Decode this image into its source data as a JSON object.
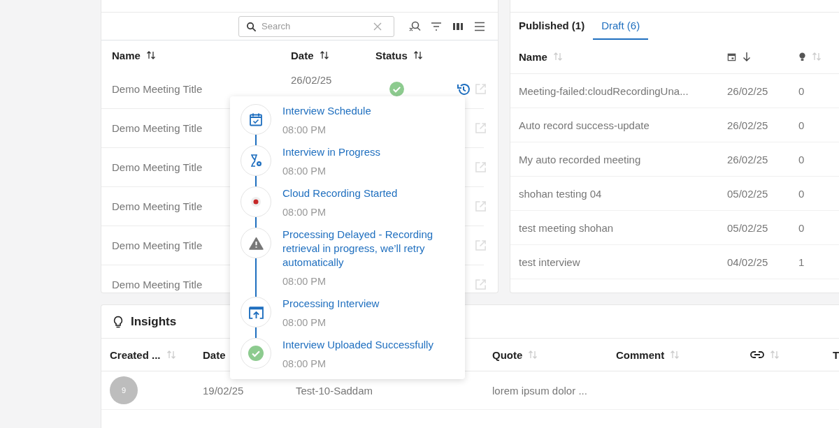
{
  "meetings_panel": {
    "search": {
      "placeholder": "Search"
    },
    "columns": [
      {
        "label": "Name"
      },
      {
        "label": "Date"
      },
      {
        "label": "Status"
      }
    ],
    "rows": [
      {
        "name": "Demo Meeting Title",
        "date": "26/02/25",
        "completed": true
      },
      {
        "name": "Demo Meeting Title"
      },
      {
        "name": "Demo Meeting Title"
      },
      {
        "name": "Demo Meeting Title"
      },
      {
        "name": "Demo Meeting Title"
      },
      {
        "name": "Demo Meeting Title"
      }
    ]
  },
  "timeline_popover": {
    "events": [
      {
        "kind": "calendar",
        "title": "Interview Schedule",
        "time": "08:00 PM"
      },
      {
        "kind": "progress",
        "title": "Interview in Progress",
        "time": "08:00 PM"
      },
      {
        "kind": "recording",
        "title": "Cloud Recording Started",
        "time": "08:00 PM"
      },
      {
        "kind": "warning",
        "title": "Processing Delayed - Recording retrieval in progress, we’ll retry automatically",
        "time": "08:00 PM"
      },
      {
        "kind": "upload",
        "title": "Processing Interview",
        "time": "08:00 PM"
      },
      {
        "kind": "success",
        "title": "Interview Uploaded Successfully",
        "time": "08:00 PM"
      }
    ]
  },
  "drafts_panel": {
    "tabs": [
      {
        "label": "Published (1)",
        "selected": false
      },
      {
        "label": "Draft (6)",
        "selected": true
      }
    ],
    "columns": [
      {
        "kind": "text",
        "label": "Name"
      },
      {
        "kind": "date"
      },
      {
        "kind": "insights"
      }
    ],
    "rows": [
      {
        "name": "Meeting-failed:cloudRecordingUna...",
        "date": "26/02/25",
        "count": "0"
      },
      {
        "name": "Auto record success-update",
        "date": "26/02/25",
        "count": "0"
      },
      {
        "name": "My auto recorded meeting",
        "date": "26/02/25",
        "count": "0"
      },
      {
        "name": "shohan testing 04",
        "date": "05/02/25",
        "count": "0"
      },
      {
        "name": "test meeting shohan",
        "date": "05/02/25",
        "count": "0"
      },
      {
        "name": "test interview",
        "date": "04/02/25",
        "count": "1"
      }
    ]
  },
  "insights": {
    "title": "Insights",
    "columns": [
      {
        "kind": "text",
        "label": "Created ..."
      },
      {
        "kind": "label",
        "label": "Date"
      },
      {
        "kind": "hidden"
      },
      {
        "kind": "text",
        "label": "Quote"
      },
      {
        "kind": "text",
        "label": "Comment"
      },
      {
        "kind": "link"
      },
      {
        "kind": "label",
        "label": "T"
      }
    ],
    "rows": [
      {
        "avatar": "9",
        "date": "19/02/25",
        "meeting": "Test-10-Saddam",
        "quote": "lorem ipsum dolor ..."
      }
    ]
  }
}
